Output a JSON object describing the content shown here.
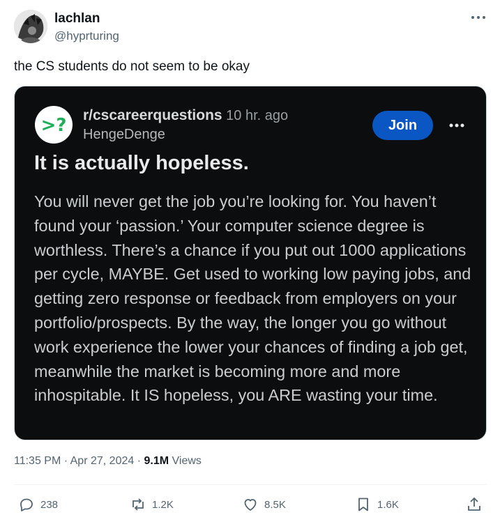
{
  "tweet": {
    "display_name": "lachlan",
    "handle": "@hyprturing",
    "text": "the CS students do not seem to be okay",
    "timestamp": "11:35 PM · Apr 27, 2024 · ",
    "views_count": "9.1M",
    "views_label": " Views"
  },
  "embed": {
    "subreddit": "r/cscareerquestions",
    "time_ago": " 10 hr. ago",
    "author": "HengeDenge",
    "join_label": "Join",
    "icon_text": ">?",
    "title": "It is actually hopeless.",
    "body": "You will never get the job you’re looking for. You haven’t found your ‘passion.’ Your computer science degree is worthless. There’s a chance if you put out 1000 applications per cycle, MAYBE. Get used to working low paying jobs, and getting zero response or feedback from employers on your portfolio/prospects. By the way, the longer you go without work experience the lower your chances of finding a job get, meanwhile the market is becoming more and more inhospitable. It IS hopeless, you ARE wasting your time."
  },
  "actions": {
    "replies": "238",
    "retweets": "1.2K",
    "likes": "8.5K",
    "bookmarks": "1.6K"
  },
  "colors": {
    "join_button": "#0a56c2",
    "subreddit_icon_bg": "#ffffff",
    "subreddit_icon_fg": "#1fae5a",
    "embed_bg": "#0b0d0e"
  },
  "icons": {
    "more_top": "more-dots-icon",
    "more_embed": "more-dots-icon",
    "reply": "reply-icon",
    "retweet": "retweet-icon",
    "like": "heart-icon",
    "bookmark": "bookmark-icon",
    "share": "share-icon"
  }
}
